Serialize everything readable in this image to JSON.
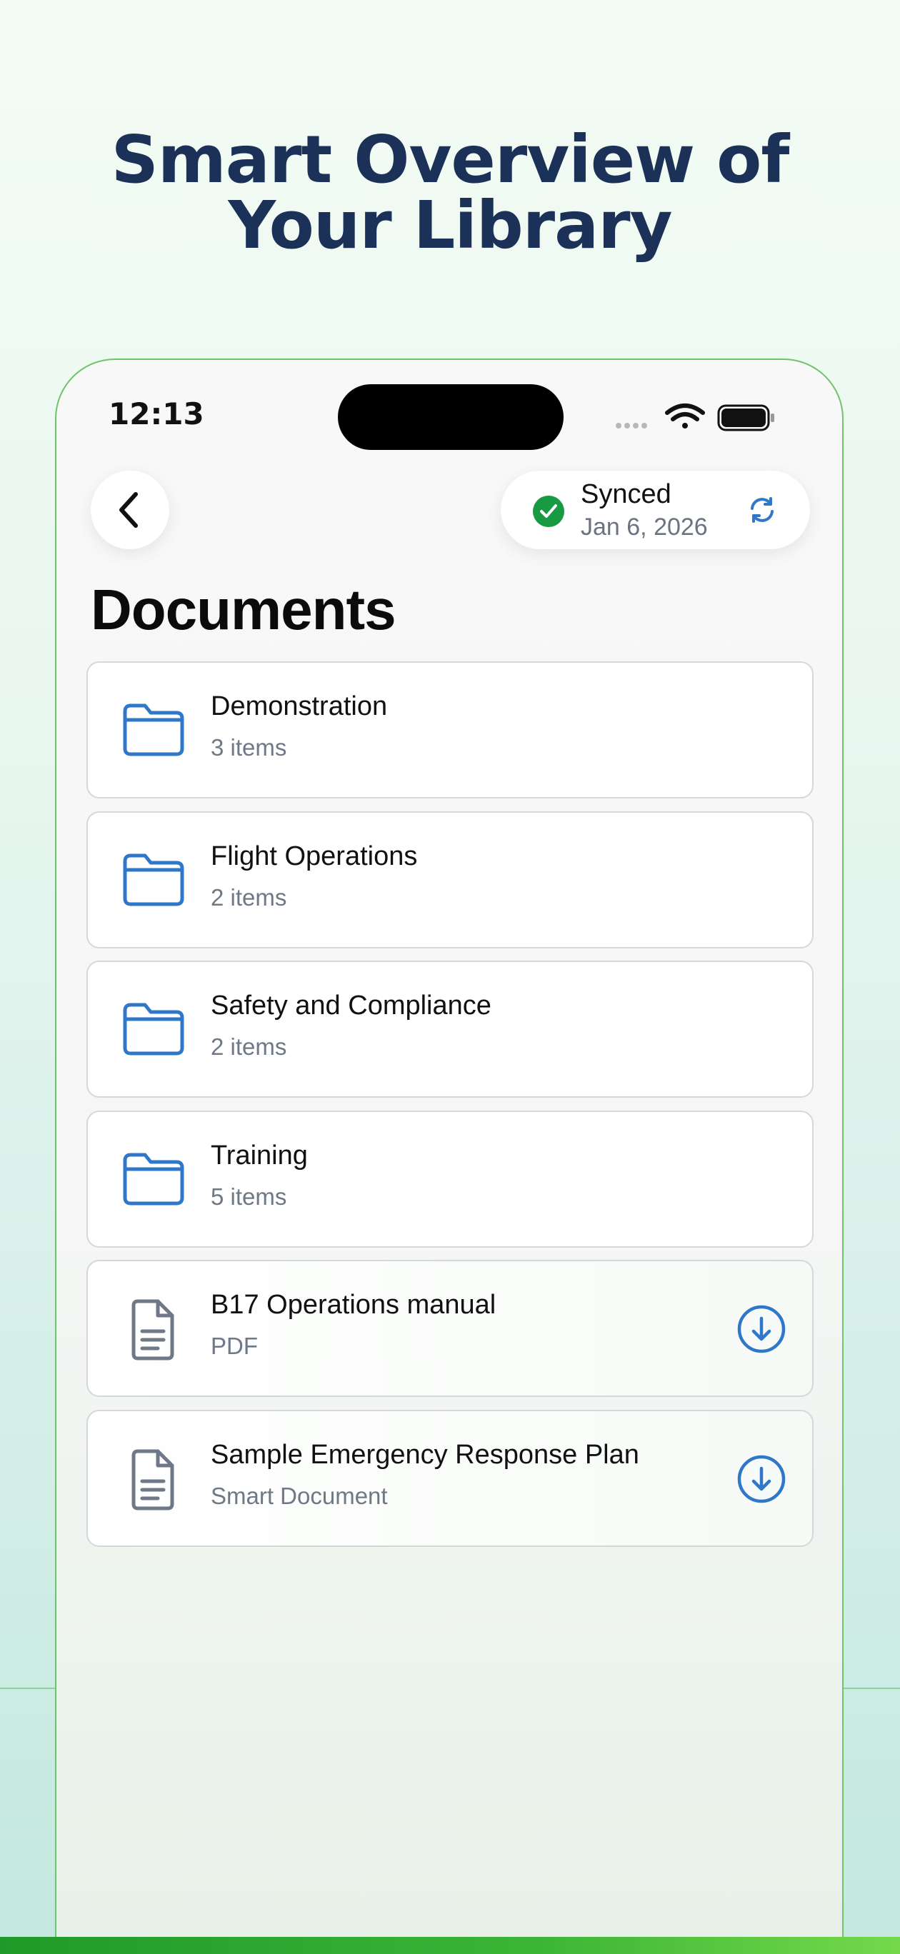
{
  "headline": {
    "line1": "Smart Overview of",
    "line2": "Your Library"
  },
  "status_bar": {
    "time": "12:13"
  },
  "nav": {
    "back_icon": "chevron-left-icon",
    "sync": {
      "title": "Synced",
      "date": "Jan 6, 2026",
      "check_color": "#179a42",
      "refresh_icon": "refresh-icon"
    }
  },
  "page_title": "Documents",
  "colors": {
    "accent": "#2f77c8",
    "headline": "#1b3158",
    "border": "#d5d7d9"
  },
  "folders": [
    {
      "title": "Demonstration",
      "subtitle": "3 items",
      "icon": "folder-icon"
    },
    {
      "title": "Flight Operations",
      "subtitle": "2 items",
      "icon": "folder-icon"
    },
    {
      "title": "Safety and Compliance",
      "subtitle": "2 items",
      "icon": "folder-icon"
    },
    {
      "title": "Training",
      "subtitle": "5 items",
      "icon": "folder-icon"
    }
  ],
  "files": [
    {
      "title": "B17 Operations manual",
      "subtitle": "PDF",
      "icon": "document-icon",
      "action_icon": "download-icon"
    },
    {
      "title": "Sample Emergency Response Plan",
      "subtitle": "Smart Document",
      "icon": "document-icon",
      "action_icon": "download-icon"
    }
  ]
}
